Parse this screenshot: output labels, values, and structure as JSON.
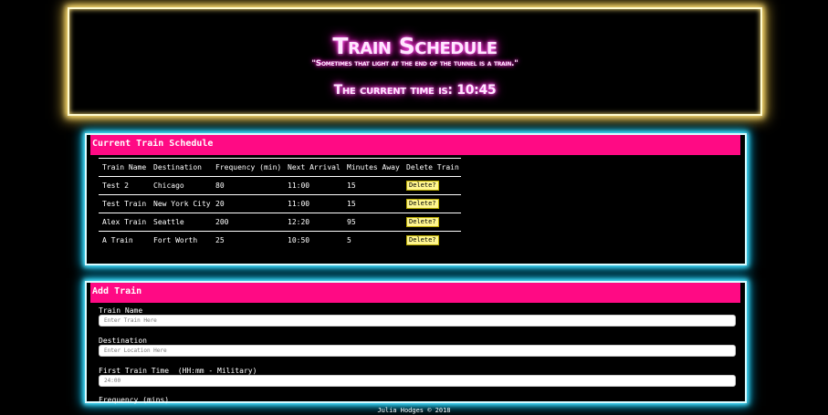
{
  "header": {
    "title": "Train Schedule",
    "quote": "\"Sometimes that light at the end of the tunnel is a train.\"",
    "current_time_label": "The current time is:",
    "current_time": "10:45"
  },
  "schedule": {
    "heading": "Current Train Schedule",
    "columns": [
      "Train Name",
      "Destination",
      "Frequency (min)",
      "Next Arrival",
      "Minutes Away",
      "Delete Train"
    ],
    "rows": [
      {
        "name": "Test 2",
        "destination": "Chicago",
        "frequency": "80",
        "next_arrival": "11:00",
        "minutes_away": "15",
        "delete_label": "Delete?"
      },
      {
        "name": "Test Train",
        "destination": "New York City",
        "frequency": "20",
        "next_arrival": "11:00",
        "minutes_away": "15",
        "delete_label": "Delete?"
      },
      {
        "name": "Alex Train",
        "destination": "Seattle",
        "frequency": "200",
        "next_arrival": "12:20",
        "minutes_away": "95",
        "delete_label": "Delete?"
      },
      {
        "name": "A Train",
        "destination": "Fort Worth",
        "frequency": "25",
        "next_arrival": "10:50",
        "minutes_away": "5",
        "delete_label": "Delete?"
      }
    ]
  },
  "add_train": {
    "heading": "Add Train",
    "name_label": "Train Name",
    "name_placeholder": "Enter Train Here",
    "destination_label": "Destination",
    "destination_placeholder": "Enter Location Here",
    "first_time_label": "First Train Time  (HH:mm - Military)",
    "first_time_placeholder": "24:00",
    "frequency_label": "Frequency (mins)"
  },
  "footer": "Julia Hodges © 2018",
  "colors": {
    "header_glow": "#ffe27a",
    "panel_glow": "#00b7e6",
    "panel_heading_bg": "#ff0a84",
    "title_glow": "#ff00c8",
    "delete_button_bg": "#fff68f"
  }
}
